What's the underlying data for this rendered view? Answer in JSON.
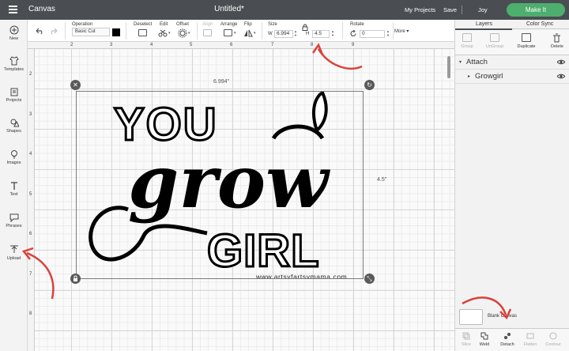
{
  "topbar": {
    "app_title": "Canvas",
    "doc_title": "Untitled*",
    "my_projects": "My Projects",
    "save": "Save",
    "separator": "|",
    "user": "Joy",
    "make_it": "Make It"
  },
  "toolbar": {
    "operation_label": "Operation",
    "operation_value": "Basic Cut",
    "deselect_label": "Deselect",
    "edit_label": "Edit",
    "offset_label": "Offset",
    "align_label": "Align",
    "arrange_label": "Arrange",
    "flip_label": "Flip",
    "size_label": "Size",
    "width_prefix": "W",
    "width_value": "6.994",
    "height_prefix": "H",
    "height_value": "4.5",
    "rotate_label": "Rotate",
    "rotate_value": "0",
    "more_label": "More",
    "more_arrow": "▾"
  },
  "leftpanel": {
    "items": [
      {
        "label": "New"
      },
      {
        "label": "Templates"
      },
      {
        "label": "Projects"
      },
      {
        "label": "Shapes"
      },
      {
        "label": "Images"
      },
      {
        "label": "Text"
      },
      {
        "label": "Phrases"
      },
      {
        "label": "Upload"
      }
    ]
  },
  "ruler": {
    "top": [
      "2",
      "3",
      "4",
      "5",
      "6",
      "7",
      "8",
      "9"
    ],
    "left": [
      "2",
      "3",
      "4",
      "5",
      "6",
      "7",
      "8"
    ]
  },
  "selection": {
    "width_label": "6.994\"",
    "height_label": "4.5\"",
    "close_glyph": "✕",
    "rotate_glyph": "↻",
    "scale_glyph": "⤡"
  },
  "artwork": {
    "line1": "YOU",
    "line2": "grow",
    "line3": "GIRL",
    "watermark": "www.artsyfartsymama.com"
  },
  "rightpanel": {
    "tab_layers": "Layers",
    "tab_color_sync": "Color Sync",
    "group": "Group",
    "ungroup": "UnGroup",
    "duplicate": "Duplicate",
    "delete": "Delete",
    "layers": [
      {
        "name": "Attach",
        "arrow": "▾"
      },
      {
        "name": "Growgirl",
        "arrow": "▸"
      }
    ],
    "blank_canvas": "Blank Canvas",
    "bottom_tools": {
      "slice": "Slice",
      "weld": "Weld",
      "detach": "Detach",
      "flatten": "Flatten",
      "contour": "Contour"
    }
  },
  "colors": {
    "topbar_bg": "#4a4e52",
    "make_it_green": "#4dae6e",
    "annotation_red": "#d9413a"
  }
}
